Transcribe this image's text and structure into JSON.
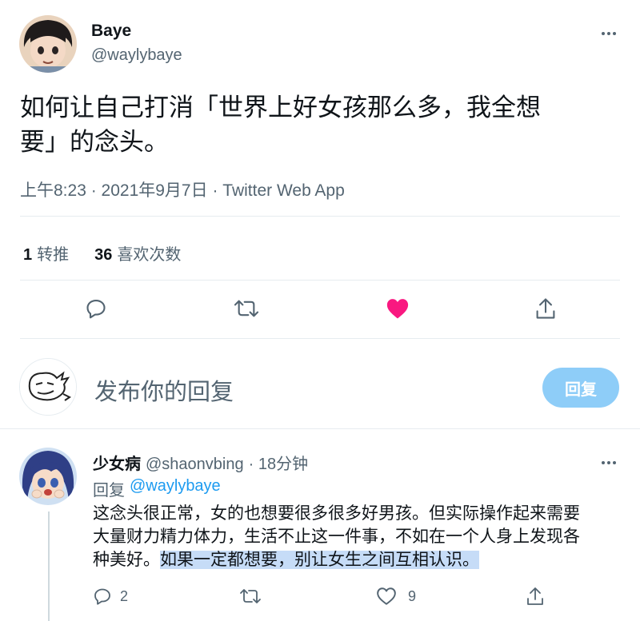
{
  "tweet": {
    "author_name": "Baye",
    "author_handle": "@waylybaye",
    "text_line1": "如何让自己打消「世界上好女孩那么多，我全想",
    "text_line2": "要」的念头。",
    "meta": "上午8:23 · 2021年9月7日 · Twitter Web App",
    "retweet_count": "1",
    "retweet_label": "转推",
    "like_count": "36",
    "like_label": "喜欢次数"
  },
  "compose": {
    "placeholder": "发布你的回复",
    "reply_button": "回复"
  },
  "reply": {
    "author_name": "少女病",
    "author_handle": "@shaonvbing",
    "time": "· 18分钟",
    "reply_to_prefix": "回复",
    "reply_to_handle": "@waylybaye",
    "line1": "这念头很正常，女的也想要很多很多好男孩。但实际操作起来需要",
    "line2": "大量财力精力体力，生活不止这一件事，不如在一个人身上发现各",
    "line3_plain": "种美好。",
    "line3_highlight": "如果一定都想要，别让女生之间互相认识。",
    "reply_count": "2",
    "like_count": "9"
  },
  "colors": {
    "like_active": "#f91880",
    "link": "#1d9bf0",
    "reply_button_bg": "#8ecdf8",
    "highlight": "#c6dcf7"
  }
}
